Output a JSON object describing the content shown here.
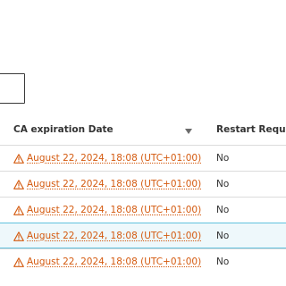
{
  "table": {
    "columns": {
      "expiration": "CA expiration Date",
      "restart": "Restart Required"
    },
    "sort_icon": "sort-descending-icon",
    "warning_icon": "warning-triangle-icon",
    "rows": [
      {
        "expiration": "August 22, 2024, 18:08 (UTC+01:00)",
        "restart": "No",
        "selected": false
      },
      {
        "expiration": "August 22, 2024, 18:08 (UTC+01:00)",
        "restart": "No",
        "selected": false
      },
      {
        "expiration": "August 22, 2024, 18:08 (UTC+01:00)",
        "restart": "No",
        "selected": false
      },
      {
        "expiration": "August 22, 2024, 18:08 (UTC+01:00)",
        "restart": "No",
        "selected": true
      },
      {
        "expiration": "August 22, 2024, 18:08 (UTC+01:00)",
        "restart": "No",
        "selected": false
      }
    ]
  },
  "colors": {
    "warning": "#d45a0f",
    "selected_border": "#5fc1dd",
    "selected_bg": "#eef8fb"
  }
}
